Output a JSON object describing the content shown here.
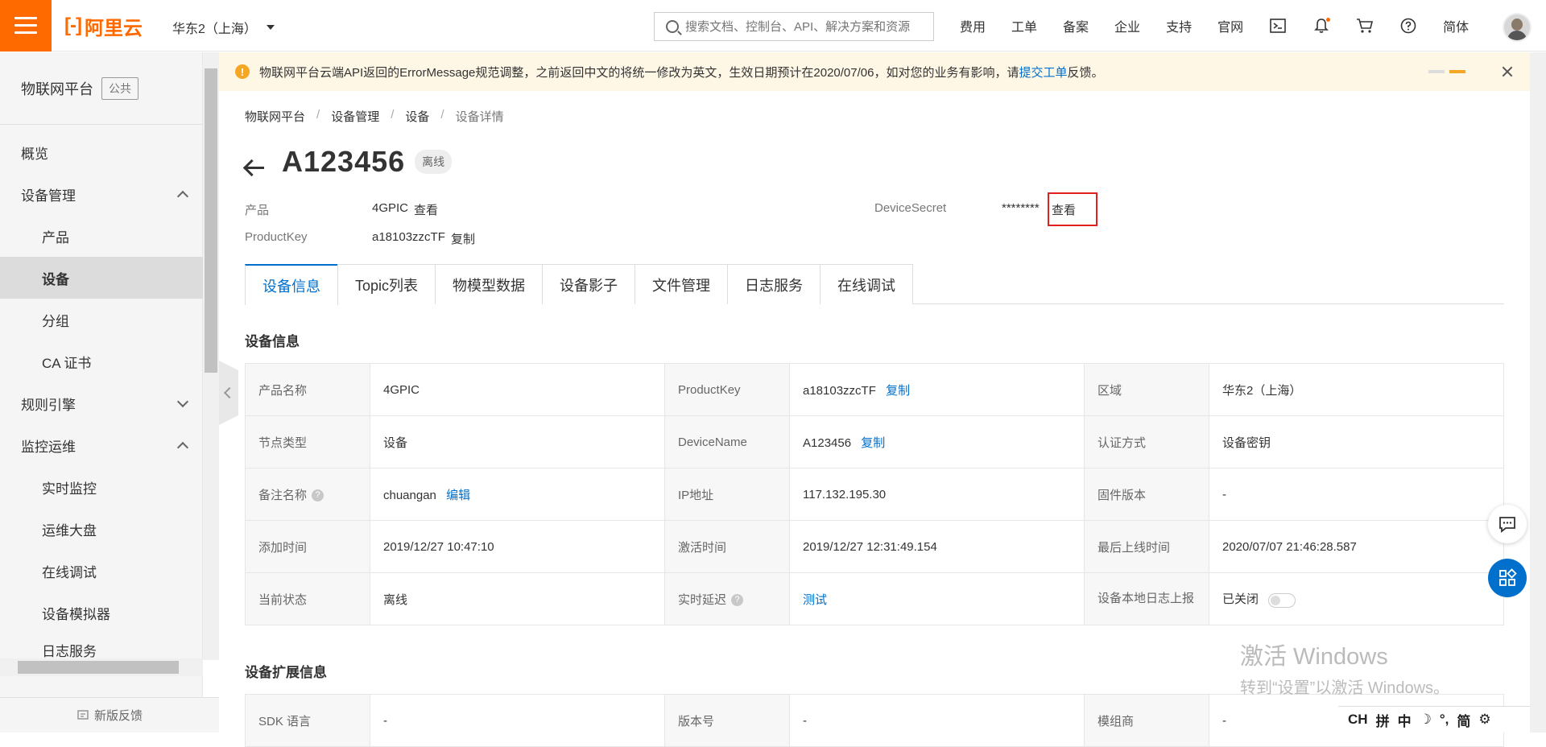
{
  "header": {
    "brand": "阿里云",
    "region": "华东2（上海）",
    "search_placeholder": "搜索文档、控制台、API、解决方案和资源",
    "nav": [
      "费用",
      "工单",
      "备案",
      "企业",
      "支持",
      "官网"
    ],
    "language": "简体"
  },
  "sidebar": {
    "title": "物联网平台",
    "badge": "公共",
    "items": [
      {
        "label": "概览",
        "level": 1
      },
      {
        "label": "设备管理",
        "level": 1,
        "expanded": true
      },
      {
        "label": "产品",
        "level": 2
      },
      {
        "label": "设备",
        "level": 2,
        "active": true
      },
      {
        "label": "分组",
        "level": 2
      },
      {
        "label": "CA 证书",
        "level": 2
      },
      {
        "label": "规则引擎",
        "level": 1,
        "expanded": false
      },
      {
        "label": "监控运维",
        "level": 1,
        "expanded": true
      },
      {
        "label": "实时监控",
        "level": 2
      },
      {
        "label": "运维大盘",
        "level": 2
      },
      {
        "label": "在线调试",
        "level": 2
      },
      {
        "label": "设备模拟器",
        "level": 2
      },
      {
        "label": "日志服务",
        "level": 2
      }
    ],
    "feedback": "新版反馈"
  },
  "notice": {
    "text_before": "物联网平台云端API返回的ErrorMessage规范调整，之前返回中文的将统一修改为英文，生效日期预计在2020/07/06，如对您的业务有影响，请",
    "link": "提交工单",
    "text_after": "反馈。"
  },
  "breadcrumb": [
    "物联网平台",
    "设备管理",
    "设备",
    "设备详情"
  ],
  "device": {
    "name": "A123456",
    "status": "离线",
    "product_label": "产品",
    "product_value": "4GPIC",
    "product_link": "查看",
    "productkey_label": "ProductKey",
    "productkey_value": "a18103zzcTF",
    "productkey_link": "复制",
    "secret_label": "DeviceSecret",
    "secret_value": "********",
    "secret_link": "查看"
  },
  "tabs": [
    "设备信息",
    "Topic列表",
    "物模型数据",
    "设备影子",
    "文件管理",
    "日志服务",
    "在线调试"
  ],
  "info": {
    "section_title": "设备信息",
    "rows": [
      [
        {
          "k": "产品名称",
          "v": "4GPIC"
        },
        {
          "k": "ProductKey",
          "v": "a18103zzcTF",
          "link": "复制"
        },
        {
          "k": "区域",
          "v": "华东2（上海）"
        }
      ],
      [
        {
          "k": "节点类型",
          "v": "设备"
        },
        {
          "k": "DeviceName",
          "v": "A123456",
          "link": "复制"
        },
        {
          "k": "认证方式",
          "v": "设备密钥"
        }
      ],
      [
        {
          "k": "备注名称",
          "v": "chuangan",
          "link": "编辑"
        },
        {
          "k": "IP地址",
          "v": "117.132.195.30"
        },
        {
          "k": "固件版本",
          "v": "-"
        }
      ],
      [
        {
          "k": "添加时间",
          "v": "2019/12/27 10:47:10"
        },
        {
          "k": "激活时间",
          "v": "2019/12/27 12:31:49.154"
        },
        {
          "k": "最后上线时间",
          "v": "2020/07/07 21:46:28.587"
        }
      ],
      [
        {
          "k": "当前状态",
          "v": "离线"
        },
        {
          "k": "实时延迟",
          "v": "测试"
        },
        {
          "k": "设备本地日志上报",
          "v": "已关闭"
        }
      ]
    ]
  },
  "ext": {
    "section_title": "设备扩展信息",
    "row": [
      {
        "k": "SDK 语言",
        "v": "-"
      },
      {
        "k": "版本号",
        "v": "-"
      },
      {
        "k": "模组商",
        "v": "-"
      }
    ]
  },
  "watermark": {
    "line1": "激活 Windows",
    "line2": "转到“设置”以激活 Windows。"
  },
  "ime": [
    "CH",
    "拼",
    "中",
    "简"
  ],
  "colors": {
    "brand": "#ff6a00",
    "link": "#0070cc",
    "highlight": "#e02020",
    "notice_bg": "#fff7e6"
  }
}
